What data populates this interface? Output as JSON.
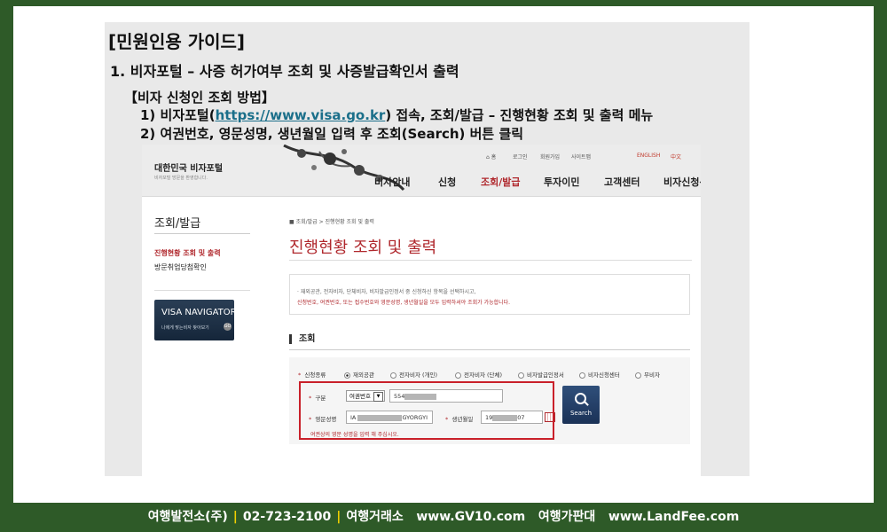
{
  "slide": {
    "title": "[민원인용 가이드]",
    "heading": "1. 비자포털 – 사증 허가여부 조회 및 사증발급확인서 출력",
    "subheading": "【비자 신청인 조회 방법】",
    "step1_pre": "1) 비자포털(",
    "step1_link": "https://www.visa.go.kr",
    "step1_post": ") 접속, 조회/발급 – 진행현황 조회 및 출력 메뉴",
    "step2": "2) 여권번호, 영문성명, 생년월일 입력 후 조회(Search) 버튼 클릭"
  },
  "portal": {
    "brand": "대한민국 비자포털",
    "brand_sub": "비자포털 방문을 환영합니다.",
    "util": {
      "home": "홈",
      "login": "로그인",
      "signup": "회원가입",
      "sitemap": "사이트맵",
      "english": "ENGLISH",
      "chinese": "中文"
    },
    "nav": [
      "비자안내",
      "신청",
      "조회/발급",
      "투자이민",
      "고객센터",
      "비자신청센터"
    ],
    "sidebar": {
      "title": "조회/발급",
      "items": [
        "진행현황 조회 및 출력",
        "방문취업당첨확인"
      ]
    },
    "navigator": {
      "title": "VISA NAVIGATOR",
      "sub": "나에게 맞는비자 찾아보기",
      "go": "GO"
    },
    "breadcrumb": "조회/발급 > 진행현황 조회 및 출력",
    "page_title": "진행현황 조회 및 출력",
    "notice_line1": "· 재외공관, 전자비자, 단체비자, 비자발급인정서 중 신청하신 항목을 선택하시고,",
    "notice_line2": "  신청번호, 여권번호, 또는 접수번호와 영문성명, 생년월일을 모두 입력하셔야 조회가 가능합니다.",
    "section": "조회",
    "form": {
      "type_label": "신청종류",
      "options": [
        "재외공관",
        "전자비자 (개인)",
        "전자비자 (단체)",
        "비자발급인정서",
        "비자신청센터",
        "무비자"
      ],
      "gubun_label": "구분",
      "gubun_select": "여권번호",
      "passport_value": "554",
      "name_label": "영문성명",
      "name_start": "IA",
      "name_end": "GYORGYI",
      "birth_label": "생년월일",
      "birth_start": "19",
      "birth_end": "07",
      "hint": "여권상의 영문 성명을 입력 해 주십시오.",
      "search_label": "Search"
    }
  },
  "footer": {
    "company": "여행발전소(주)",
    "phone": "02-723-2100",
    "tagline": "여행거래소",
    "site1": "www.GV10.com",
    "tagline2": "여행가판대",
    "site2": "www.LandFee.com"
  },
  "colors": {
    "accent_red": "#b0282d",
    "border_green": "#2e5a28",
    "link_teal": "#1b6f8a",
    "footer_separator": "#f1d000"
  }
}
